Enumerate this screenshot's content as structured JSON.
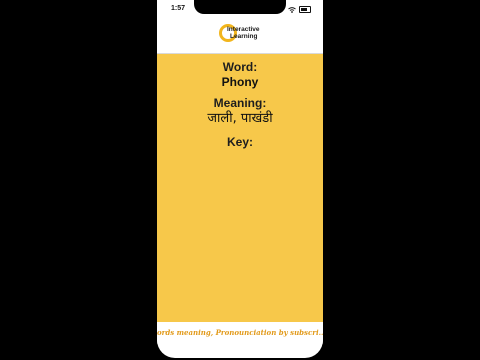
{
  "status_bar": {
    "time": "1:57"
  },
  "logo": {
    "line1": "Interactive",
    "line2": "Learning"
  },
  "card": {
    "word_label": "Word:",
    "word_value": "Phony",
    "meaning_label": "Meaning:",
    "meaning_value": "जाली, पाखंडी",
    "key_label": "Key:"
  },
  "ticker": {
    "text": "ords meaning, Pronounciation by subscri..."
  },
  "colors": {
    "card_background": "#f7c84a",
    "ticker_text": "#e29a1a",
    "logo_ring": "#f2b51c"
  }
}
